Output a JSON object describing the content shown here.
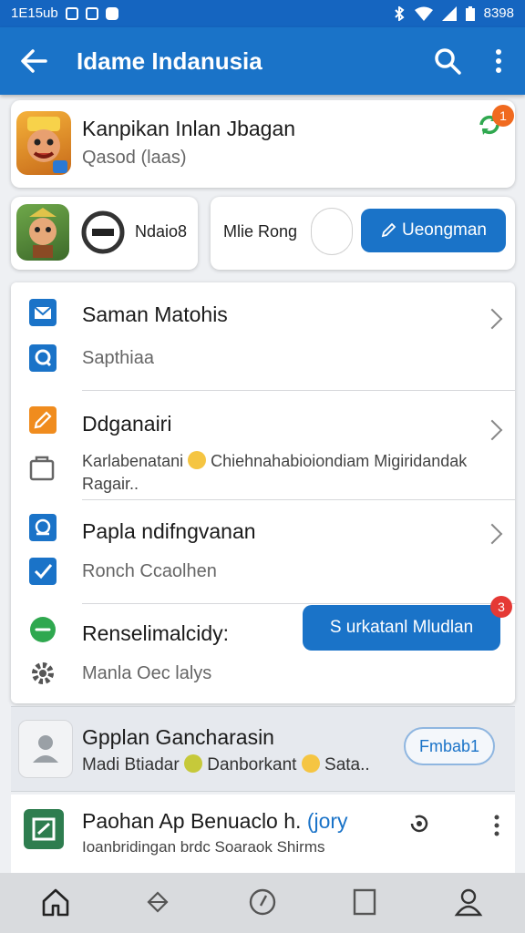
{
  "status_bar": {
    "time": "1E15ub",
    "battery_text": "8398"
  },
  "app_bar": {
    "title": "Idame Indanusia"
  },
  "featured_app": {
    "title": "Kanpikan Inlan Jbagan",
    "subtitle": "Qasod (laas)",
    "badge": "1"
  },
  "small_card_left": {
    "label": "Ndaio8"
  },
  "small_card_right": {
    "label": "Mlie Rong",
    "button": "Ueongman"
  },
  "menu": {
    "item1": {
      "title": "Saman Matohis",
      "subtitle": "Sapthiaa"
    },
    "item2": {
      "title": "Ddganairi",
      "desc_a": "Karlabenatani",
      "desc_b": "Chiehnahabioiondiam Migiridandak",
      "desc_c": "Ragair.."
    },
    "item3": {
      "title": "Papla ndifngvanan",
      "subtitle": "Ronch Ccaolhen"
    },
    "item4": {
      "title": "Renselimalcidy:",
      "subtitle": "Manla Oec lalys",
      "button": "S urkatanl Mludlan",
      "badge": "3"
    }
  },
  "highlight": {
    "title": "Gpplan Gancharasin",
    "desc_a": "Madi Btiadar",
    "desc_b": "Danborkant",
    "desc_c": "Sata..",
    "button": "Fmbab1"
  },
  "last_item": {
    "title": "Paohan Ap Benuaclo h.",
    "link": "(jory",
    "subtitle": "Ioanbridingan brdc Soaraok Shirms"
  },
  "colors": {
    "primary": "#1a73c8",
    "status_bar": "#1565c0",
    "badge": "#f06a1f",
    "nav_bar": "#d9dbde"
  },
  "icons": [
    "arrow-back-icon",
    "search-icon",
    "more-vert-icon",
    "sync-icon",
    "mail-icon",
    "chat-icon",
    "edit-icon",
    "folder-icon",
    "location-icon",
    "checkbox-icon",
    "message-icon",
    "gear-icon",
    "person-icon",
    "image-icon",
    "refresh-icon",
    "home-icon",
    "diamond-icon",
    "compass-icon",
    "book-icon",
    "profile-icon"
  ]
}
